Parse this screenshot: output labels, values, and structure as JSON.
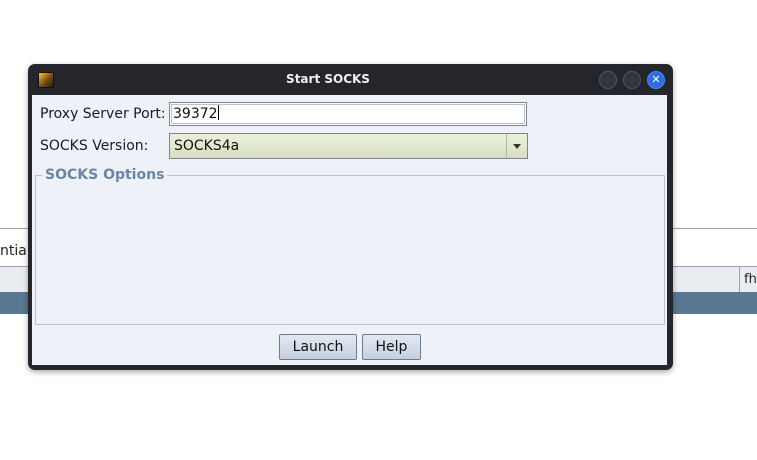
{
  "background": {
    "tab_text": "ntial",
    "column_label": "fh"
  },
  "dialog": {
    "title": "Start SOCKS",
    "close_glyph": "✕",
    "fields": {
      "port_label": "Proxy Server Port:",
      "port_value": "39372",
      "version_label": "SOCKS Version:",
      "version_value": "SOCKS4a"
    },
    "options_group_label": "SOCKS Options",
    "buttons": {
      "launch": "Launch",
      "help": "Help"
    }
  },
  "colors": {
    "titlebar": "#24262b",
    "close_button": "#2a6ee0",
    "content_background": "#eef1f8",
    "group_label": "#6a86a6",
    "selected_row": "#5a7892"
  },
  "icons": {
    "app": "app-icon",
    "close": "close-icon",
    "dropdown": "chevron-down-icon"
  }
}
